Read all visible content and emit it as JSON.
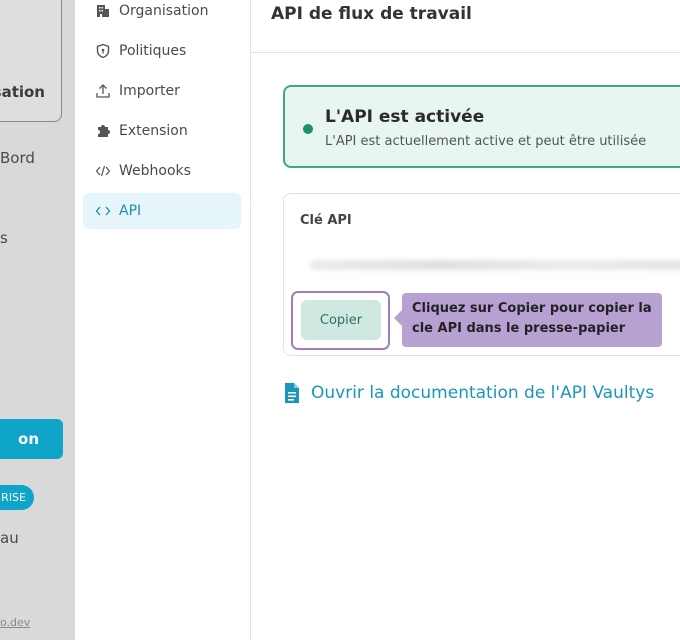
{
  "background": {
    "card_text": "sation",
    "texts": [
      "Bord",
      "s",
      "au"
    ],
    "primary_button": "on",
    "badge": "RISE",
    "link": "o.dev"
  },
  "nav": {
    "items": [
      {
        "label": "Organisation",
        "icon": "building-icon"
      },
      {
        "label": "Politiques",
        "icon": "shield-icon"
      },
      {
        "label": "Importer",
        "icon": "upload-icon"
      },
      {
        "label": "Extension",
        "icon": "puzzle-icon"
      },
      {
        "label": "Webhooks",
        "icon": "code-icon"
      },
      {
        "label": "API",
        "icon": "code-icon"
      }
    ],
    "active": "API"
  },
  "header": {
    "title": "API de flux de travail"
  },
  "status": {
    "title": "L'API est activée",
    "description": "L'API est actuellement active et peut être utilisée"
  },
  "api_key": {
    "label": "Clé API",
    "copy_label": "Copier",
    "tooltip": "Cliquez sur Copier pour copier la cle API dans le presse-papier"
  },
  "docs_link": {
    "label": "Ouvrir la documentation de l'API Vaultys",
    "icon": "document-icon"
  },
  "colors": {
    "accent": "#0fa5c9",
    "success_border": "#3fa88a",
    "success_bg": "#e7f6f1",
    "tooltip_bg": "#b7a0d2",
    "highlight_border": "#9b7fbf"
  }
}
